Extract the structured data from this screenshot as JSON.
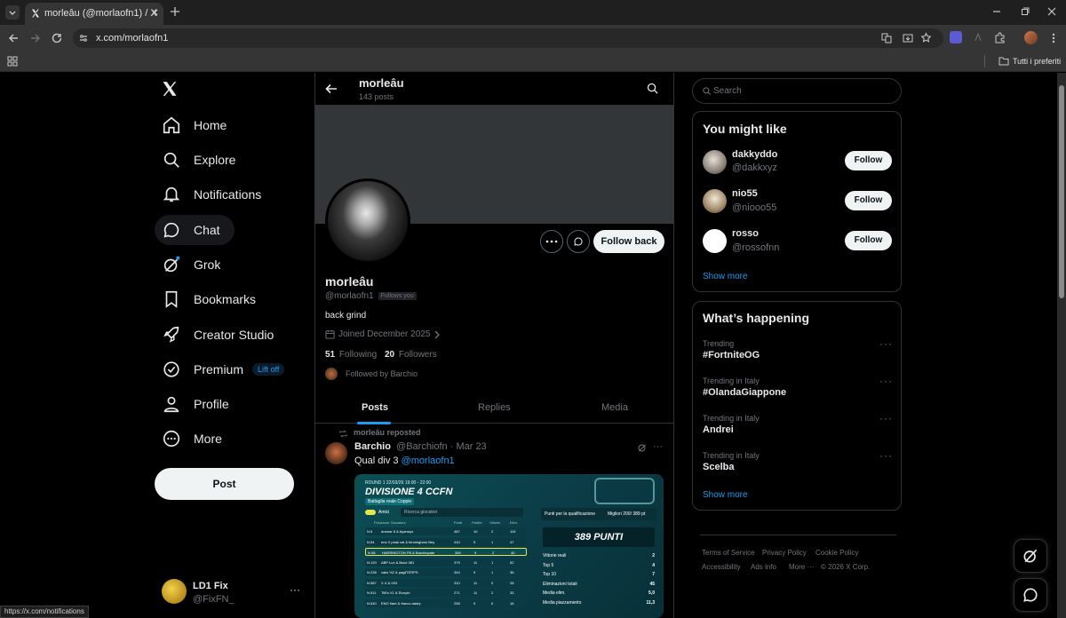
{
  "browser": {
    "tab_title": "morleâu (@morlaofn1) / X",
    "url": "x.com/morlaofn1",
    "bookmarks_label": "Tutti i preferiti",
    "status_url": "https://x.com/notifications"
  },
  "nav": {
    "items": [
      {
        "label": "Home",
        "icon": "home-icon"
      },
      {
        "label": "Explore",
        "icon": "search-icon"
      },
      {
        "label": "Notifications",
        "icon": "bell-icon"
      },
      {
        "label": "Chat",
        "icon": "chat-icon"
      },
      {
        "label": "Grok",
        "icon": "grok-icon"
      },
      {
        "label": "Bookmarks",
        "icon": "bookmark-icon"
      },
      {
        "label": "Creator Studio",
        "icon": "rocket-icon"
      },
      {
        "label": "Premium",
        "icon": "verified-icon"
      },
      {
        "label": "Profile",
        "icon": "person-icon"
      },
      {
        "label": "More",
        "icon": "more-circle-icon"
      }
    ],
    "premium_badge": "Lift off",
    "post_label": "Post",
    "account": {
      "name": "LD1 Fix",
      "handle": "@FixFN_"
    }
  },
  "profile": {
    "header_name": "morleâu",
    "header_posts": "143 posts",
    "name": "morleâu",
    "handle": "@morlaofn1",
    "follows_you": "Follows you",
    "bio": "back grind",
    "joined": "Joined December 2025",
    "following_count": "51",
    "following_label": "Following",
    "followers_count": "20",
    "followers_label": "Followers",
    "followed_by": "Followed by Barchio",
    "follow_back_label": "Follow back",
    "tabs": [
      "Posts",
      "Replies",
      "Media"
    ],
    "active_tab": "Posts"
  },
  "tweet": {
    "reposted_by": "morleâu reposted",
    "author": "Barchio",
    "handle_date": "@Barchiofn · Mar 23",
    "text": "Qual div 3",
    "mention": "@morlaofn1",
    "image": {
      "round_info": "ROUND 1  22/03/26 19:00 - 22:00",
      "title": "DIVISIONE 4 CCFN",
      "mode": "Battaglia reale  Coppie",
      "friends_label": "Amici",
      "search_placeholder": "Ricerca giocatori",
      "columns": [
        "Posizione Giocatore",
        "Punti",
        "Partite",
        "Vittorie",
        "Elim."
      ],
      "rows": [
        [
          "N.5",
          "dramar 8 & Ayarrays",
          "487",
          "10",
          "2",
          "119"
        ],
        [
          "N.54",
          "enz X peak val & birmingham Ney",
          "410",
          "9",
          "1",
          "47"
        ],
        [
          "N.98",
          "HARRINGTON FB & Barchiopate",
          "389",
          "9",
          "2",
          "40"
        ],
        [
          "N.120",
          "ABP Lux & Bulut 381",
          "379",
          "11",
          "1",
          "52"
        ],
        [
          "N.238",
          "vaks ½2 & pagliTERPS",
          "344",
          "9",
          "1",
          "36"
        ],
        [
          "N.587",
          "X X & 003",
          "310",
          "11",
          "0",
          "28"
        ],
        [
          "N.511",
          "TiiEs X1 & Eloxyfv",
          "271",
          "11",
          "2",
          "33"
        ],
        [
          "N.540",
          "ENO flare & franco dadry",
          "258",
          "9",
          "0",
          "16"
        ]
      ],
      "panel_title": "Punti per la qualificazione",
      "panel_best": "Migliori 200/ 389 pt",
      "points": "389 PUNTI",
      "stats": [
        [
          "Vittorie reali",
          "2"
        ],
        [
          "Top 5",
          "4"
        ],
        [
          "Top 10",
          "7"
        ],
        [
          "Eliminazioni totali",
          "45"
        ],
        [
          "Media elim.",
          "5,0"
        ],
        [
          "Media piazzamento",
          "11,3"
        ]
      ]
    }
  },
  "right": {
    "search_placeholder": "Search",
    "you_might_like": "You might like",
    "suggestions": [
      {
        "name": "dakkyddo",
        "handle": "@dakkxyz"
      },
      {
        "name": "nio55",
        "handle": "@niooo55"
      },
      {
        "name": "rosso",
        "handle": "@rossofnn"
      }
    ],
    "follow_label": "Follow",
    "show_more": "Show more",
    "whats_happening": "What’s happening",
    "trends": [
      {
        "label": "Trending",
        "name": "#FortniteOG"
      },
      {
        "label": "Trending in Italy",
        "name": "#OlandaGiappone"
      },
      {
        "label": "Trending in Italy",
        "name": "Andrei"
      },
      {
        "label": "Trending in Italy",
        "name": "Scelba"
      }
    ],
    "footer": [
      "Terms of Service",
      "Privacy Policy",
      "Cookie Policy",
      "Accessibility",
      "Ads info",
      "More ···",
      "© 2026 X Corp."
    ]
  },
  "colors": {
    "accent": "#1d9bf0",
    "background": "#000000",
    "border": "#2f3336",
    "muted": "#71767b"
  }
}
